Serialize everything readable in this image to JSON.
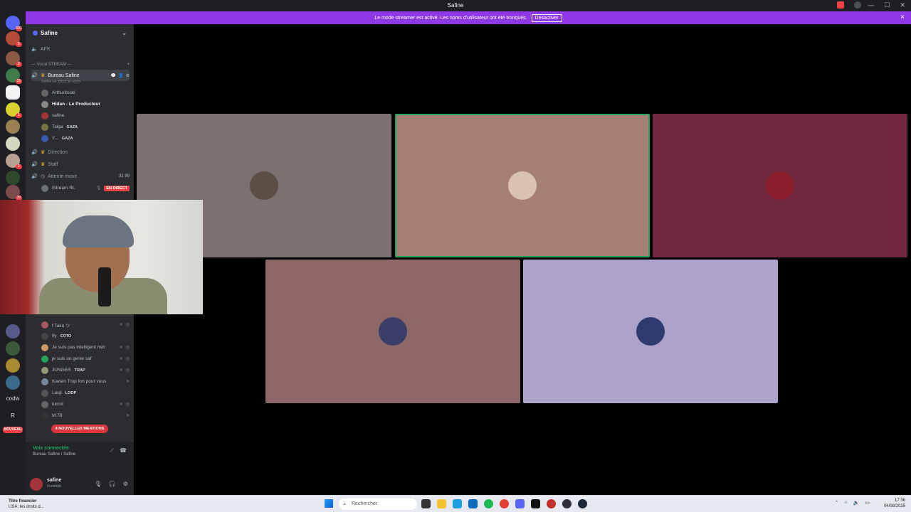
{
  "window": {
    "title": "Safine"
  },
  "banner": {
    "text": "Le mode streamer est activé. Les noms d'utilisateur ont été tronqués.",
    "button": "Désactiver",
    "close": "×"
  },
  "servers": [
    {
      "badge": "591"
    },
    {
      "badge": "5"
    },
    {
      "badge": "8"
    },
    {
      "badge": "21"
    },
    {
      "badge": ""
    },
    {
      "badge": "1"
    },
    {
      "badge": ""
    },
    {
      "badge": ""
    },
    {
      "badge": "2"
    },
    {
      "badge": ""
    },
    {
      "badge": "20"
    }
  ],
  "server_texts": {
    "codw": "codw",
    "r": "R",
    "new": "NOUVEAU"
  },
  "sidebar": {
    "server_name": "Safine",
    "afk": "AFK",
    "category": "— Vocal STREAM —",
    "active_channel": "Bureau Safine",
    "active_status": "Définir un statut de salon",
    "users_bureau": [
      {
        "name": "Arthuritoski",
        "bold": false,
        "tag": ""
      },
      {
        "name": "Hidan - Le Producteur",
        "bold": true,
        "tag": ""
      },
      {
        "name": "safine",
        "bold": false,
        "tag": ""
      },
      {
        "name": "Talga",
        "bold": false,
        "tag": "GAZA"
      },
      {
        "name": "Y...",
        "bold": false,
        "tag": "GAZA"
      }
    ],
    "channels": [
      {
        "name": "Direction"
      },
      {
        "name": "Staff"
      },
      {
        "name": "Attente move",
        "counts": "32  99"
      }
    ],
    "live_user": "iStream RL",
    "live_label": "EN DIRECT",
    "users_lower": [
      {
        "name": "f Taku ツ",
        "tag": ""
      },
      {
        "name": "Ily",
        "tag": "COTO"
      },
      {
        "name": "Je suis pas intelligent mdr",
        "tag": ""
      },
      {
        "name": "je suis un genie saf",
        "tag": ""
      },
      {
        "name": "JUNGER",
        "tag": "TRAP"
      },
      {
        "name": "Kawen Trop fort pour vous",
        "tag": ""
      },
      {
        "name": "Lauji",
        "tag": "LOOP"
      },
      {
        "name": "lucrol",
        "tag": ""
      },
      {
        "name": "M.78",
        "tag": ""
      }
    ],
    "mentions": "4 NOUVELLES MENTIONS"
  },
  "voice_panel": {
    "title": "Voix connectée",
    "subtitle": "Bureau Safine / Safine"
  },
  "user_panel": {
    "name": "safine",
    "status": "Invisible"
  },
  "stage": {
    "tiles": [
      {
        "color": "#7b726f",
        "avatar": "#5b4e44",
        "speaking": false
      },
      {
        "color": "#a57f73",
        "avatar": "#d8c2b0",
        "speaking": true
      },
      {
        "color": "#71293f",
        "avatar": "#8a1e2c",
        "speaking": false
      },
      {
        "color": "#8d6867",
        "avatar": "#3a3f6a",
        "speaking": false
      },
      {
        "color": "#ada2ca",
        "avatar": "#2f3a6e",
        "speaking": false
      }
    ]
  },
  "taskbar": {
    "weather_title": "Titre financier",
    "weather_sub": "USA: les droits d...",
    "search_placeholder": "Rechercher",
    "time": "17:36",
    "date": "04/08/2025"
  }
}
